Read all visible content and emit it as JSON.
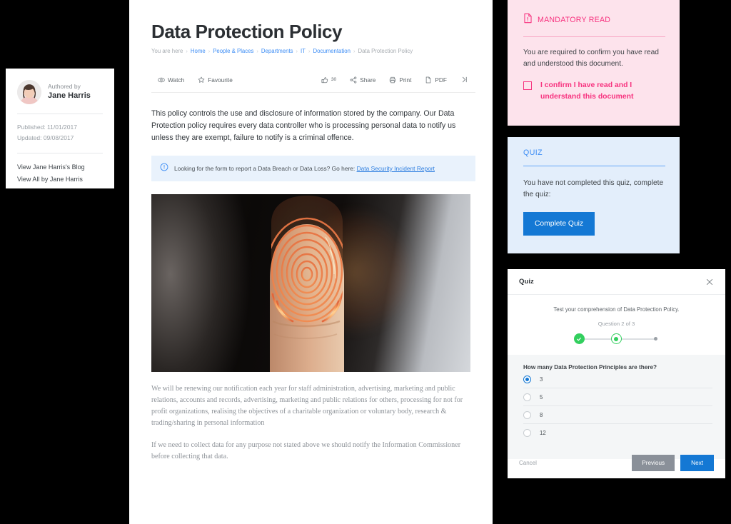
{
  "author_card": {
    "authored_by_label": "Authored by",
    "author_name": "Jane Harris",
    "published": "Published: 11/01/2017",
    "updated": "Updated: 09/08/2017",
    "link_blog": "View Jane Harris's Blog",
    "link_all": "View All by Jane Harris"
  },
  "document": {
    "title": "Data Protection Policy",
    "breadcrumb": {
      "prefix": "You are here",
      "items": [
        {
          "label": "Home",
          "link": true
        },
        {
          "label": "People & Places",
          "link": true
        },
        {
          "label": "Departments",
          "link": true
        },
        {
          "label": "IT",
          "link": true
        },
        {
          "label": "Documentation",
          "link": true
        },
        {
          "label": "Data Protection Policy",
          "link": false
        }
      ],
      "separator": "›"
    },
    "toolbar": {
      "watch_label": "Watch",
      "favourite_label": "Favourite",
      "like_count": "30",
      "share_label": "Share",
      "print_label": "Print",
      "pdf_label": "PDF"
    },
    "lead_paragraph": "This policy controls the use and disclosure of information stored by the company. Our Data Protection policy requires every data controller who is processing personal data to notify us unless they are exempt, failure to notify is a criminal offence.",
    "callout": {
      "text": "Looking for the form to report a Data Breach or Data Loss? Go here: ",
      "link_label": "Data Security Incident Report"
    },
    "hero_image_alt": "Fingertip with illuminated orange fingerprint scan",
    "paragraphs": [
      "We will be renewing our notification each year for staff administration, advertising, marketing and public relations, accounts and records, advertising, marketing and public relations for others, processing for not for profit organizations, realising the objectives of a charitable organization or voluntary body, research & trading/sharing in personal information",
      "If we need to collect data for any purpose not stated above we should notify the Information Commissioner before collecting that data."
    ]
  },
  "mandatory_read": {
    "heading": "MANDATORY READ",
    "body": "You are required to confirm you have read and understood this document.",
    "confirm_label": "I confirm I have read and I understand this document",
    "checked": false,
    "accent_color": "#f7337f",
    "background_color": "#fde3ec"
  },
  "quiz_panel": {
    "heading": "QUIZ",
    "body": "You have not completed this quiz, complete the quiz:",
    "button_label": "Complete Quiz",
    "accent_color": "#3d8df5",
    "background_color": "#e3eefb",
    "button_color": "#1478d4"
  },
  "quiz_modal": {
    "title": "Quiz",
    "subtitle": "Test your comprehension of Data Protection Policy.",
    "question_counter": "Question 2 of 3",
    "steps": [
      {
        "state": "done"
      },
      {
        "state": "current"
      },
      {
        "state": "todo"
      }
    ],
    "question": "How many Data Protection Principles are there?",
    "options": [
      {
        "label": "3",
        "selected": true
      },
      {
        "label": "5",
        "selected": false
      },
      {
        "label": "8",
        "selected": false
      },
      {
        "label": "12",
        "selected": false
      }
    ],
    "cancel_label": "Cancel",
    "previous_label": "Previous",
    "next_label": "Next",
    "step_done_color": "#32cf5e",
    "step_todo_color": "#9aa0a6"
  }
}
